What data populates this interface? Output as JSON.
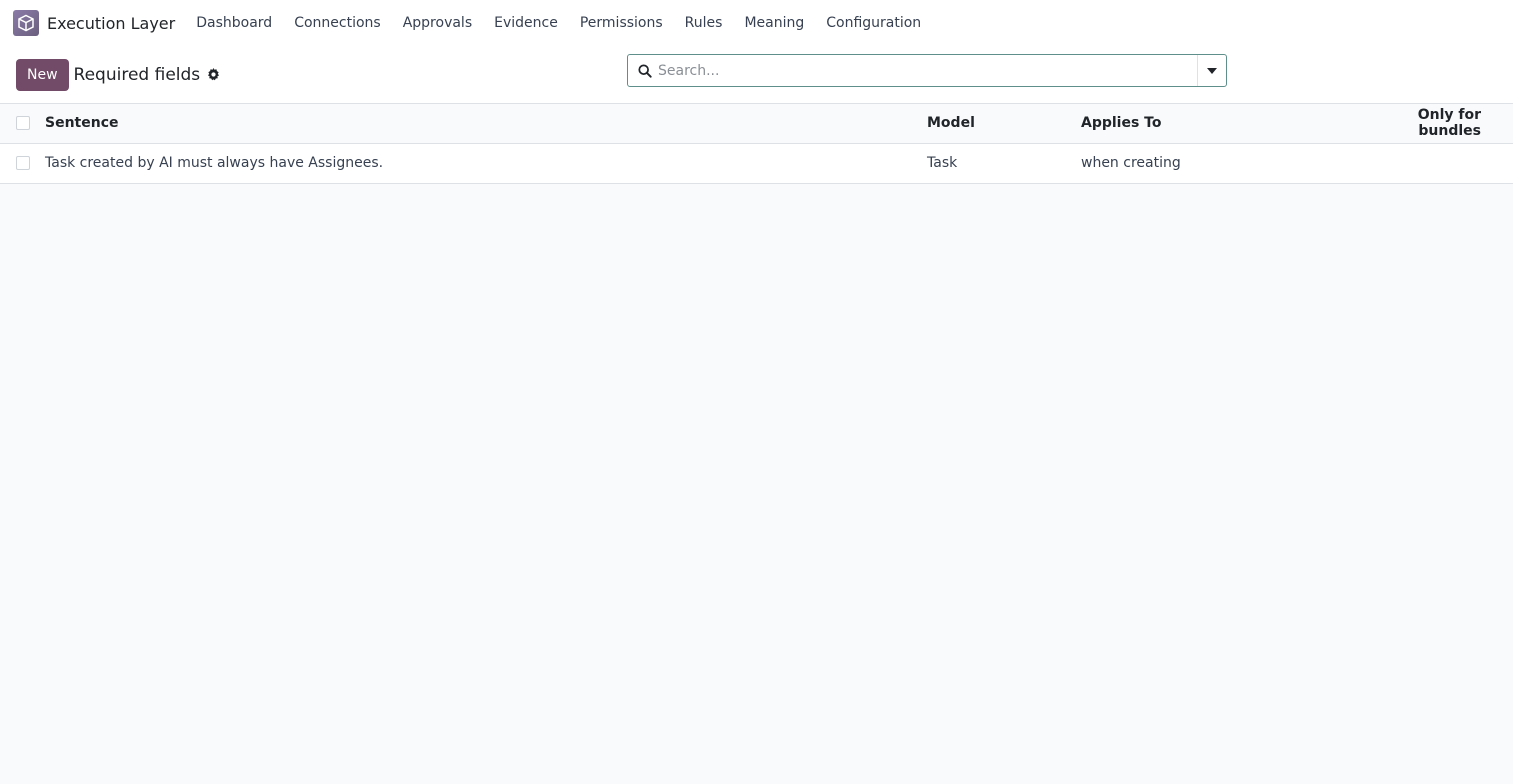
{
  "app": {
    "name": "Execution Layer",
    "icon": "app-cube-icon",
    "icon_color": "#71639e"
  },
  "nav": {
    "items": [
      {
        "label": "Dashboard"
      },
      {
        "label": "Connections"
      },
      {
        "label": "Approvals"
      },
      {
        "label": "Evidence"
      },
      {
        "label": "Permissions"
      },
      {
        "label": "Rules"
      },
      {
        "label": "Meaning"
      },
      {
        "label": "Configuration"
      }
    ]
  },
  "control_panel": {
    "new_label": "New",
    "title": "Required fields",
    "settings_icon": "gear-icon",
    "accent_color": "#714b67"
  },
  "search": {
    "placeholder": "Search...",
    "value": ""
  },
  "table": {
    "columns": [
      "Sentence",
      "Model",
      "Applies To",
      "Only for bundles"
    ],
    "rows": [
      {
        "sentence": "Task created by AI must always have Assignees.",
        "model": "Task",
        "applies_to": "when creating",
        "only_for_bundles": ""
      }
    ]
  }
}
